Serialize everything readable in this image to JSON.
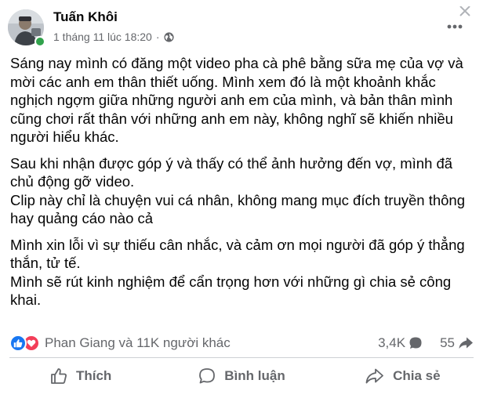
{
  "post": {
    "author": "Tuấn Khôi",
    "timestamp": "1 tháng 11 lúc 18:20",
    "separator": "·",
    "audience_icon": "globe-icon",
    "paragraphs": [
      [
        "Sáng nay mình có đăng một video pha cà phê bằng sữa mẹ của vợ và mời các anh em thân thiết uống. Mình xem đó là một khoảnh khắc nghịch ngợm giữa những người anh em của mình, và bản thân mình cũng chơi rất thân với những anh em này, không nghĩ sẽ khiến nhiều người hiểu khác."
      ],
      [
        "Sau khi nhận được góp ý và thấy có thể ảnh hưởng đến vợ, mình đã chủ động gỡ video.",
        "Clip này chỉ là chuyện vui cá nhân, không mang mục đích truyền thông hay quảng cáo nào cả"
      ],
      [
        "Mình xin lỗi vì sự thiếu cân nhắc, và cảm ơn mọi người đã góp ý thẳng thắn, tử tế.",
        "Mình sẽ rút kinh nghiệm để cẩn trọng hơn với những gì chia sẻ công khai."
      ]
    ]
  },
  "reactions": {
    "types": [
      "like",
      "love"
    ],
    "summary": "Phan Giang và 11K người khác",
    "comments_count": "3,4K",
    "shares_count": "55"
  },
  "actions": {
    "like_label": "Thích",
    "comment_label": "Bình luận",
    "share_label": "Chia sẻ"
  },
  "colors": {
    "text": "#050505",
    "secondary": "#65676b",
    "like_blue": "#1877f2",
    "love_red": "#f33e58",
    "online_green": "#31a24c"
  }
}
